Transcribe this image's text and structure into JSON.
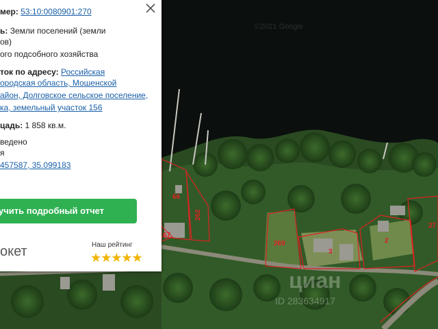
{
  "popup": {
    "cadastral_label": "мер:",
    "cadastral_link": "53:10:0080901:270",
    "category_label": "ь:",
    "category_text_1": "Земли поселений (земли",
    "category_text_2": "ов)",
    "usage_text": "ого подсобного хозяйства",
    "address_label": "ток по адресу:",
    "address_link_1": "Российская",
    "address_link_2": "ородская область, Мошенской",
    "address_link_3": "айон, Долговское сельское поселение,",
    "address_link_4": "ка, земельный участок 156",
    "area_label": "цадь:",
    "area_value": "1 858 кв.м.",
    "status_text_1": "ведено",
    "status_text_2": "я",
    "coords_link": "457587, 35.099183",
    "report_button": "учить подробный отчет",
    "brand": "окет",
    "rating_label": "Наш рейтинг",
    "rating_value": 5,
    "stars": "★★★★★"
  },
  "map": {
    "copyright": "©2021 Google",
    "watermark": "циан",
    "watermark_id": "ID 283634917",
    "plots": [
      "66",
      "262",
      "67",
      "269",
      "3",
      "2",
      "27"
    ]
  },
  "colors": {
    "link": "#1a5fa8",
    "button": "#2fb152",
    "plot_border": "#d22",
    "star": "#f1b400"
  }
}
